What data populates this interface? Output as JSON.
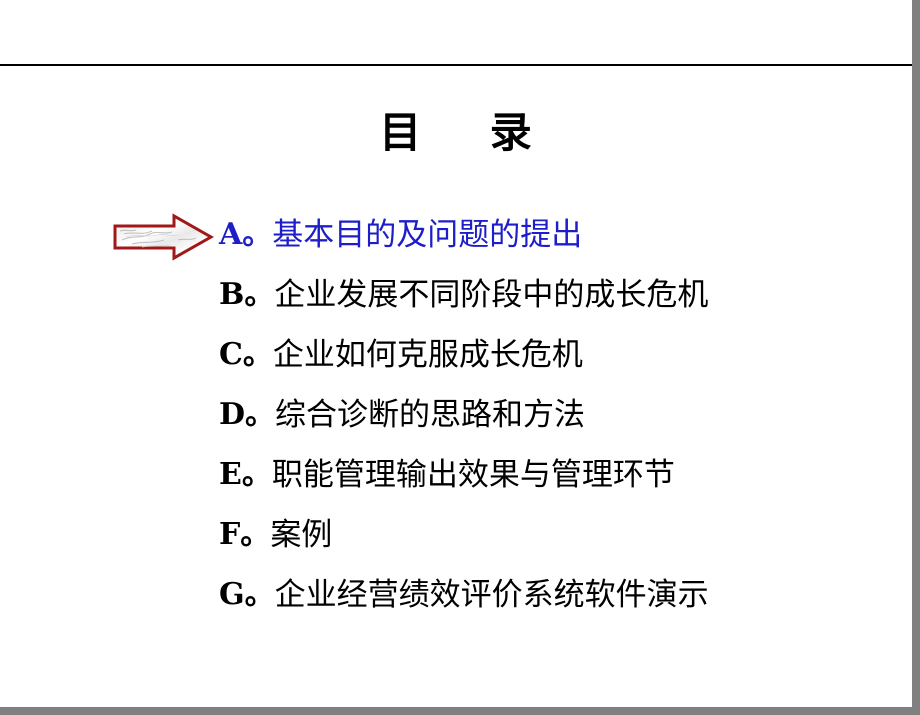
{
  "slide": {
    "title": "目    录",
    "background_color": "#ffffff",
    "rule_color": "#000000",
    "edge_color": "#808080",
    "highlight_color": "#1E1EC8",
    "arrow_outline_color": "#A01818"
  },
  "toc": {
    "items": [
      {
        "letter": "A。",
        "label": "基本目的及问题的提出",
        "highlighted": true
      },
      {
        "letter": "B。",
        "label": "企业发展不同阶段中的成长危机",
        "highlighted": false
      },
      {
        "letter": "C。",
        "label": "企业如何克服成长危机",
        "highlighted": false
      },
      {
        "letter": "D。",
        "label": "综合诊断的思路和方法",
        "highlighted": false
      },
      {
        "letter": "E。",
        "label": "职能管理输出效果与管理环节",
        "highlighted": false
      },
      {
        "letter": "F。",
        "label": "案例",
        "highlighted": false
      },
      {
        "letter": "G。",
        "label": "企业经营绩效评价系统软件演示",
        "highlighted": false
      }
    ]
  },
  "pointer": {
    "icon": "right-arrow-icon",
    "points_to": "A。基本目的及问题的提出"
  }
}
